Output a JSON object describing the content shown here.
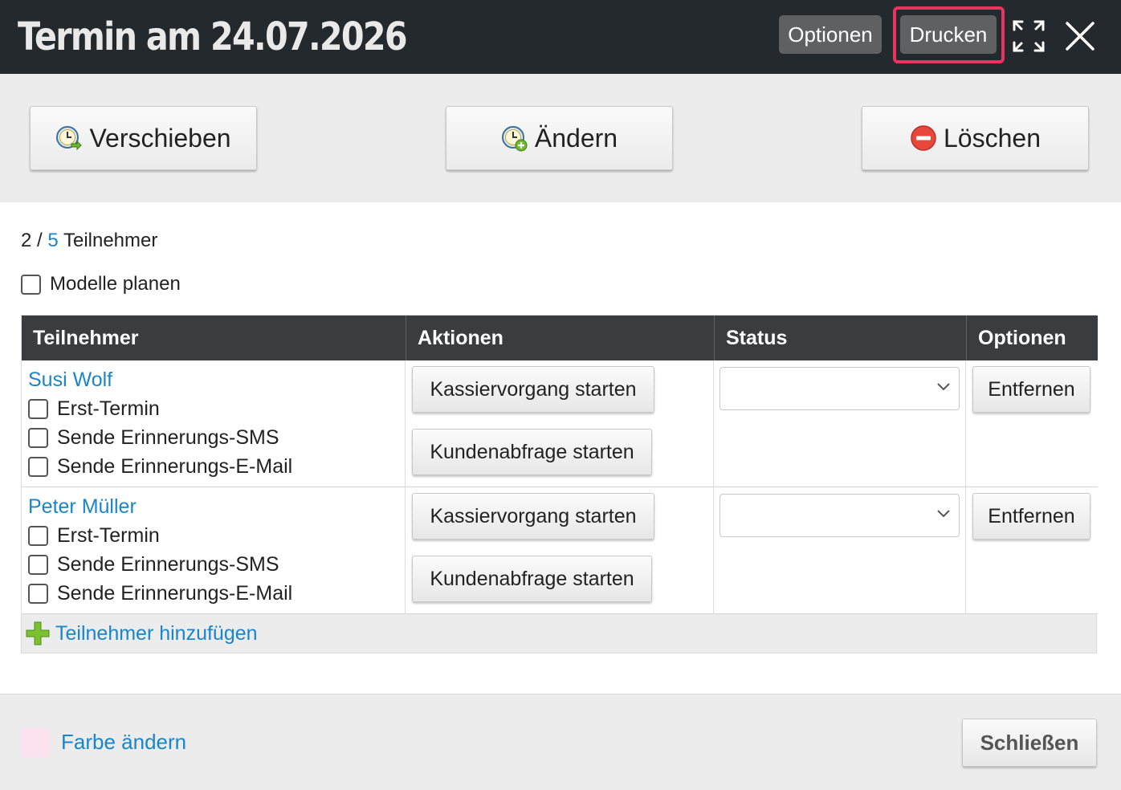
{
  "header": {
    "title": "Termin am 24.07.2026",
    "options_label": "Optionen",
    "print_label": "Drucken"
  },
  "actions": {
    "move_label": "Verschieben",
    "edit_label": "Ändern",
    "delete_label": "Löschen"
  },
  "participants_summary": {
    "current": "2",
    "separator": "/",
    "max": "5",
    "label": "Teilnehmer"
  },
  "plan_models_label": "Modelle planen",
  "table": {
    "columns": [
      "Teilnehmer",
      "Aktionen",
      "Status",
      "Optionen"
    ],
    "rows": [
      {
        "name": "Susi Wolf",
        "checks": [
          "Erst-Termin",
          "Sende Erinnerungs-SMS",
          "Sende Erinnerungs-E-Mail"
        ],
        "action1": "Kassiervorgang starten",
        "action2": "Kundenabfrage starten",
        "status": "",
        "remove": "Entfernen"
      },
      {
        "name": "Peter Müller",
        "checks": [
          "Erst-Termin",
          "Sende Erinnerungs-SMS",
          "Sende Erinnerungs-E-Mail"
        ],
        "action1": "Kassiervorgang starten",
        "action2": "Kundenabfrage starten",
        "status": "",
        "remove": "Entfernen"
      }
    ],
    "add_label": "Teilnehmer hinzufügen"
  },
  "footer": {
    "color_label": "Farbe ändern",
    "close_label": "Schließen"
  },
  "colors": {
    "header_bg": "#23292d",
    "link_blue": "#1a85c8",
    "highlight": "#e8345e",
    "swatch": "#fde3ef"
  },
  "icons": [
    "expand-icon",
    "close-icon",
    "clock-move-icon",
    "clock-edit-icon",
    "delete-icon",
    "plus-icon",
    "chevron-down-icon"
  ]
}
